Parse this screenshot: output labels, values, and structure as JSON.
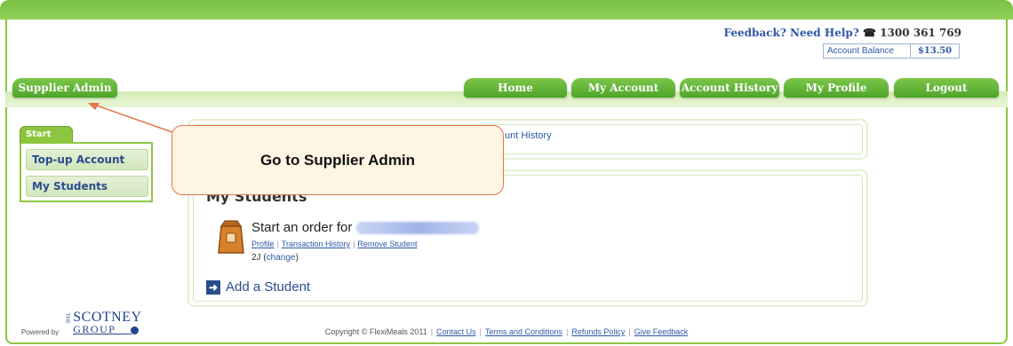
{
  "header": {
    "feedback_help": "Feedback? Need Help?",
    "phone_icon": "telephone-icon",
    "phone": "1300 361 769",
    "balance_label": "Account Balance",
    "balance_value": "$13.50"
  },
  "nav": {
    "supplier_admin": "Supplier Admin",
    "home": "Home",
    "my_account": "My Account",
    "account_history": "Account History",
    "my_profile": "My Profile",
    "logout": "Logout"
  },
  "sidebar": {
    "tab": "Start",
    "items": [
      "Top-up Account",
      "My Students"
    ]
  },
  "main": {
    "history_fragment": "unt History",
    "heading": "My Students",
    "order_prefix": "Start an order for",
    "student_links": [
      "Profile",
      "Transaction History",
      "Remove Student"
    ],
    "class_code": "2J",
    "change_link": "change",
    "add_student": "Add a Student"
  },
  "callout": {
    "text": "Go to Supplier Admin"
  },
  "footer": {
    "powered_by": "Powered by",
    "logo_the": "THE",
    "logo_line1": "SCOTNEY",
    "logo_line2": "GROUP",
    "copyright": "Copyright © FlexiMeals 2011",
    "links": [
      "Contact Us",
      "Terms and Conditions",
      "Refunds Policy",
      "Give Feedback"
    ]
  },
  "colors": {
    "brand_green": "#7ec342",
    "link_blue": "#2e58a8",
    "callout_border": "#e3764c",
    "callout_fill": "#fff5e3"
  }
}
